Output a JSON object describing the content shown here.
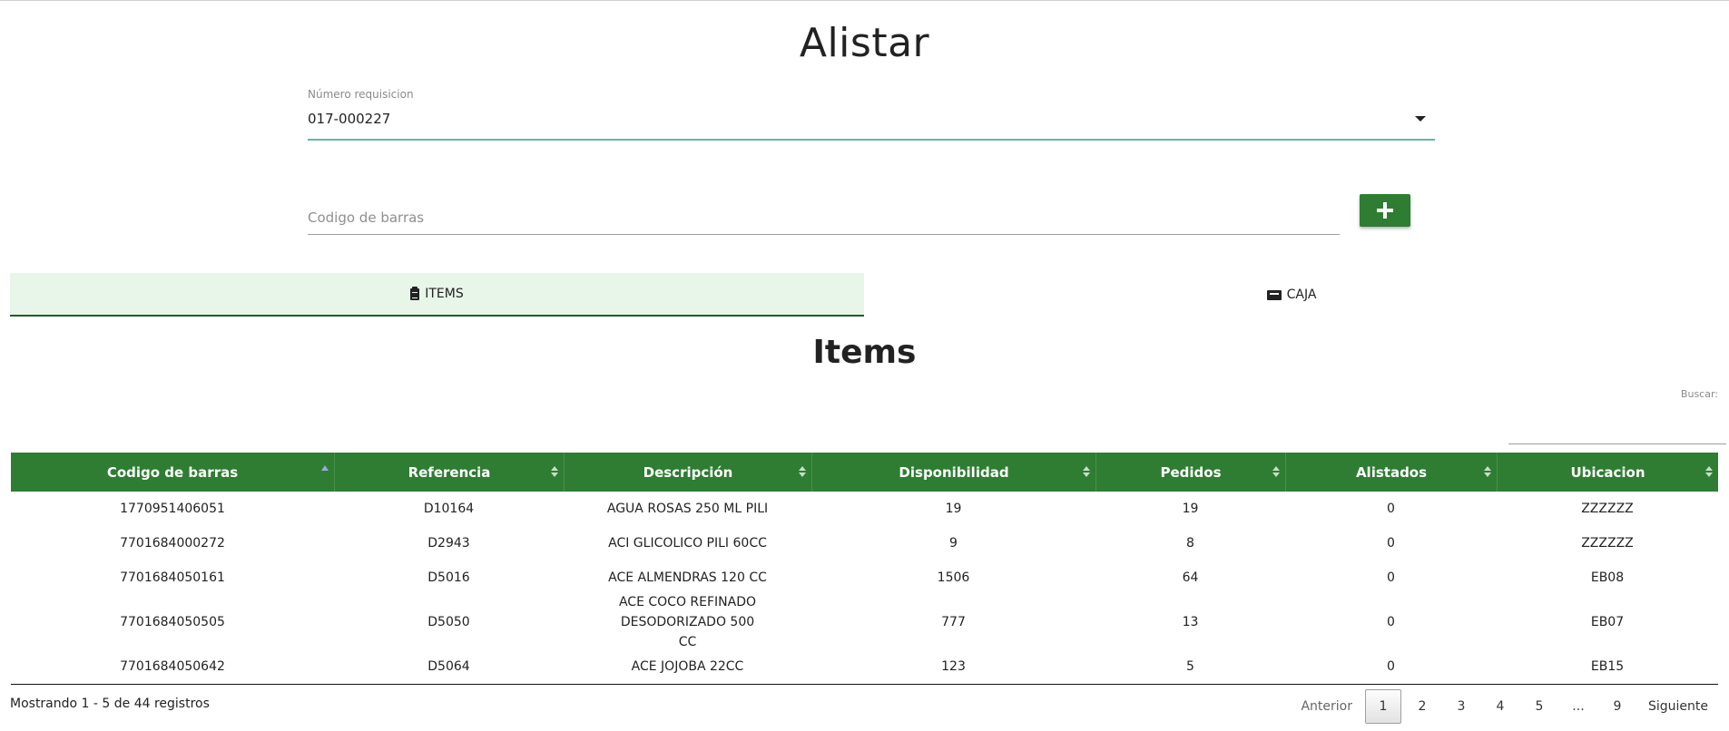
{
  "page": {
    "title": "Alistar"
  },
  "requisition": {
    "label": "Número requisicion",
    "value": "017-000227"
  },
  "barcode": {
    "placeholder": "Codigo de barras",
    "add_icon": "plus-icon"
  },
  "tabs": [
    {
      "label": "ITEMS",
      "icon": "clipboard-icon",
      "active": true
    },
    {
      "label": "CAJA",
      "icon": "box-icon",
      "active": false
    }
  ],
  "items_section": {
    "title": "Items",
    "search_label": "Buscar:"
  },
  "table": {
    "columns": [
      "Codigo de barras",
      "Referencia",
      "Descripción",
      "Disponibilidad",
      "Pedidos",
      "Alistados",
      "Ubicacion"
    ],
    "sorted_column": "Codigo de barras",
    "rows": [
      [
        "1770951406051",
        "D10164",
        "AGUA ROSAS 250 ML PILI",
        "19",
        "19",
        "0",
        "ZZZZZZ"
      ],
      [
        "7701684000272",
        "D2943",
        "ACI GLICOLICO PILI 60CC",
        "9",
        "8",
        "0",
        "ZZZZZZ"
      ],
      [
        "7701684050161",
        "D5016",
        "ACE ALMENDRAS 120 CC",
        "1506",
        "64",
        "0",
        "EB08"
      ],
      [
        "7701684050505",
        "D5050",
        "ACE COCO REFINADO DESODORIZADO 500 CC",
        "777",
        "13",
        "0",
        "EB07"
      ],
      [
        "7701684050642",
        "D5064",
        "ACE JOJOBA 22CC",
        "123",
        "5",
        "0",
        "EB15"
      ]
    ]
  },
  "footer": {
    "info": "Mostrando 1 - 5 de 44 registros",
    "prev": "Anterior",
    "pages": [
      "1",
      "2",
      "3",
      "4",
      "5",
      "...",
      "9"
    ],
    "current_page": "1",
    "next": "Siguiente"
  },
  "colors": {
    "primary": "#2e7d32",
    "tab_active_bg": "#e8f5e9",
    "select_underline": "#67b5a8"
  }
}
